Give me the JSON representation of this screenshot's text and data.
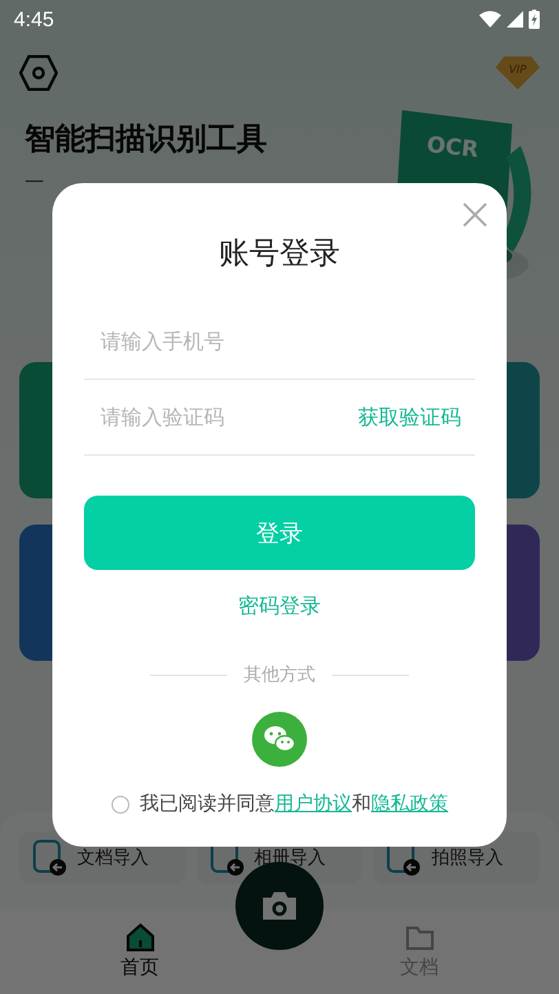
{
  "status_bar": {
    "time": "4:45"
  },
  "home": {
    "vip_label": "VIP",
    "headline": "智能扫描识别工具",
    "subtitle": "一",
    "illustration_label": "OCR",
    "quick_actions": [
      {
        "label": "文档导入"
      },
      {
        "label": "相册导入"
      },
      {
        "label": "拍照导入"
      }
    ],
    "nav": [
      {
        "label": "首页",
        "selected": true
      },
      {
        "label": "文档",
        "selected": false
      }
    ]
  },
  "dialog": {
    "title": "账号登录",
    "phone": {
      "placeholder": "请输入手机号"
    },
    "code": {
      "placeholder": "请输入验证码",
      "action": "获取验证码"
    },
    "login_button": "登录",
    "alt_login": "密码登录",
    "divider": "其他方式",
    "agreement": {
      "checked": false,
      "text": "我已阅读并同意",
      "links": [
        "用户协议",
        "隐私政策"
      ],
      "joiner": "和"
    }
  }
}
